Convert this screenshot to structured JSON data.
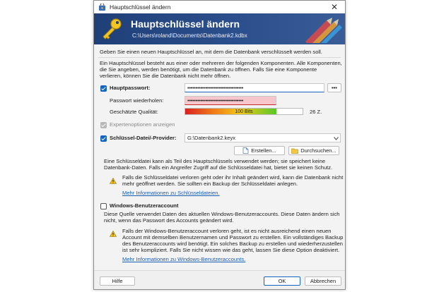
{
  "window": {
    "title": "Hauptschlüssel ändern",
    "close_glyph": "✕"
  },
  "header": {
    "title": "Hauptschlüssel ändern",
    "path": "C:\\Users\\roland\\Documents\\Datenbank2.kdbx"
  },
  "intro": "Geben Sie einen neuen Hauptschlüssel an, mit dem die Datenbank verschlüsselt werden soll.",
  "description": [
    "Ein Hauptschlüssel besteht aus einer oder mehreren der folgenden Komponenten. Alle Komponenten,",
    "die Sie angeben, werden benötigt, um die Datenbank zu öffnen. Falls Sie eine Komponente",
    "verlieren, können Sie die Datenbank nicht mehr öffnen."
  ],
  "password": {
    "label": "Hauptpasswort:",
    "value": "••••••••••••••••••••••••••••••••••",
    "toggle": "•••",
    "repeat_label": "Passwort wiederholen:",
    "repeat_value": "••••••••••••••••••••••••••••••••••",
    "quality_label": "Geschätzte Qualität:",
    "quality_bits": "100 Bits",
    "quality_fraction": 0.78,
    "char_count": "26 Z."
  },
  "expert": {
    "label": "Expertenoptionen anzeigen"
  },
  "keyfile": {
    "label": "Schlüssel-Datei/-Provider:",
    "value": "G:\\Datenbank2.keyx",
    "create_button": "Erstellen...",
    "browse_button": "Durchsuchen...",
    "info": [
      "Eine Schlüsseldatei kann als Teil des Hauptschlüssels verwendet werden; sie speichert keine",
      "Datenbank-Daten. Falls ein Angreifer Zugriff auf die Schlüsseldatei hat, bietet sie keinen Schutz."
    ],
    "warning": [
      "Falls die Schlüsseldatei verloren geht oder ihr Inhalt geändert wird, kann die Datenbank nicht",
      "mehr geöffnet werden. Sie sollten ein Backup der Schlüsseldatei anlegen."
    ],
    "more_link": "Mehr Informationen zu Schlüsseldateien."
  },
  "windows_account": {
    "label": "Windows-Benutzeraccount",
    "info": [
      "Diese Quelle verwendet Daten des aktuellen Windows-Benutzeraccounts. Diese Daten ändern sich",
      "nicht, wenn das Passwort des Accounts geändert wird."
    ],
    "warning": [
      "Falls der Windows-Benutzeraccount verloren geht, ist es nicht ausreichend einen neuen",
      "Account mit demselben Benutzernamen und Passwort zu erstellen. Ein vollständiges Backup",
      "des Benutzeraccounts wird benötigt. Ein solches Backup zu erstellen und wiederherzustellen",
      "ist sehr kompliziert. Falls Sie nicht wissen wie das geht, lassen Sie diese Option deaktiviert."
    ],
    "more_link": "Mehr Informationen zu Windows-Benutzeraccounts."
  },
  "footer": {
    "help": "Hilfe",
    "ok": "OK",
    "cancel": "Abbrechen"
  },
  "colors": {
    "banner": "#2b4f8c",
    "accent": "#1565c0",
    "error_field": "#f7c6cc",
    "link": "#1a5fb4"
  }
}
